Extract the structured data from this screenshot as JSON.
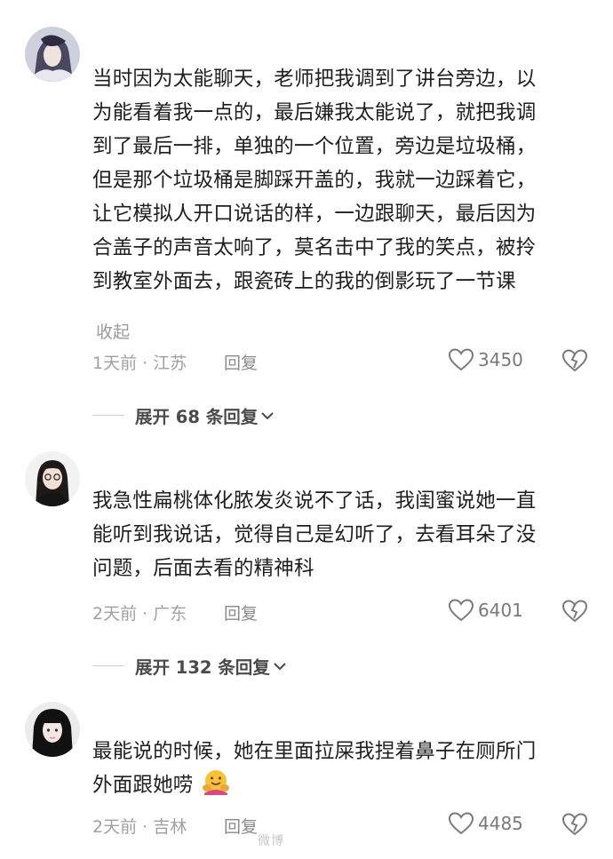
{
  "comments": [
    {
      "text_lines": [
        "当时因为太能聊天，老师把我调到了讲台旁边，以",
        "为能看着我一点的，最后嫌我太能说了，就把我调",
        "到了最后一排，单独的一个位置，旁边是垃圾桶，",
        "但是那个垃圾桶是脚踩开盖的，我就一边踩着它，",
        "让它模拟人开口说话的样，一边跟聊天，最后因为",
        "合盖子的声音太响了，莫名击中了我的笑点，被拎",
        "到教室外面去，跟瓷砖上的我的倒影玩了一节课"
      ],
      "collapse_label": "收起",
      "meta": "1天前 · 江苏",
      "reply_label": "回复",
      "likes": "3450",
      "expand_label": "展开 68 条回复"
    },
    {
      "text_lines": [
        "我急性扁桃体化脓发炎说不了话，我闺蜜说她一直",
        "能听到我说话，觉得自己是幻听了，去看耳朵了没",
        "问题，后面去看的精神科"
      ],
      "meta": "2天前 · 广东",
      "reply_label": "回复",
      "likes": "6401",
      "expand_label": "展开 132 条回复"
    },
    {
      "text_lines": [
        "最能说的时候，她在里面拉屎我捏着鼻子在厕所门",
        "外面跟她唠"
      ],
      "meta": "2天前 · 吉林",
      "reply_label": "回复",
      "likes": "4485"
    }
  ],
  "watermark": "微博"
}
